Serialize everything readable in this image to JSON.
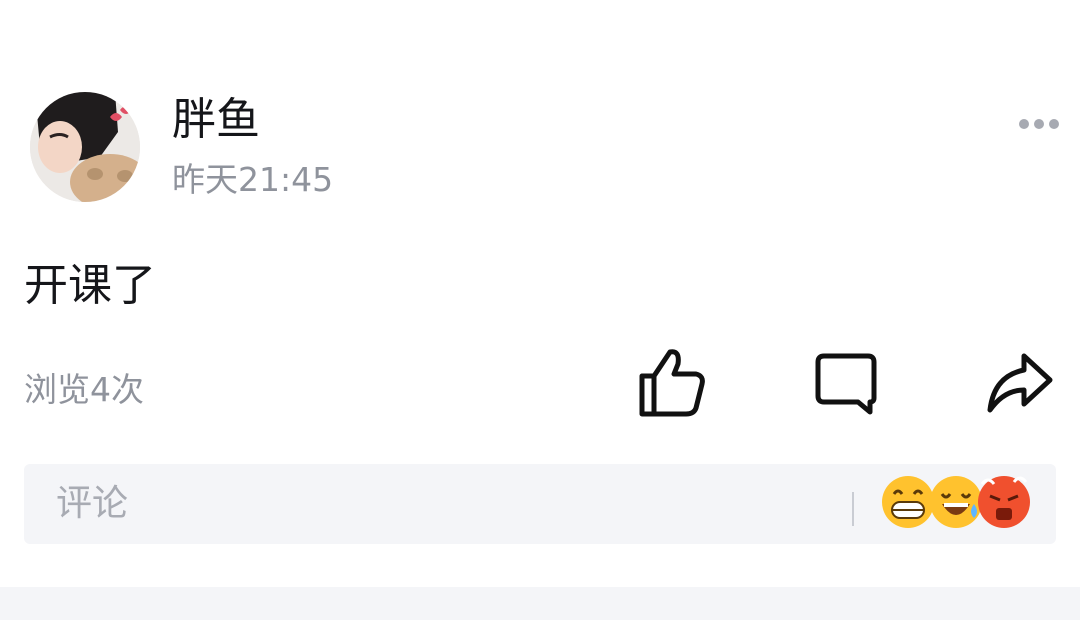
{
  "post": {
    "author": "胖鱼",
    "timestamp": "昨天21:45",
    "content": "开课了",
    "views_label": "浏览4次",
    "avatar_icon": "avatar-photo",
    "more_icon": "more-dots-icon"
  },
  "actions": {
    "like_icon": "thumbs-up-icon",
    "comment_icon": "comment-bubble-icon",
    "share_icon": "share-arrow-icon"
  },
  "comment_bar": {
    "placeholder": "评论",
    "emojis": [
      "grin-emoji",
      "laugh-tears-emoji",
      "angry-emoji"
    ]
  },
  "colors": {
    "text_primary": "#15161a",
    "text_secondary": "#8f939c",
    "comment_bg": "#f4f5f8"
  }
}
